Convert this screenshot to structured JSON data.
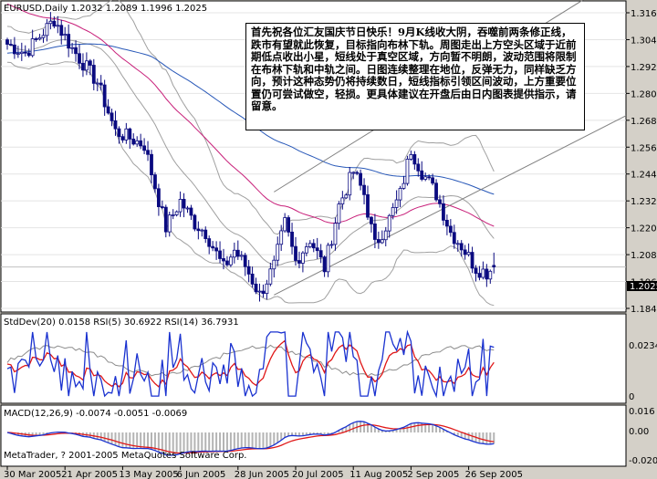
{
  "colors": {
    "background": "#ffffff",
    "frame": "#d4d0c8",
    "candle": "#0a0a80",
    "bollinger": "#a0a0a0",
    "ma_magenta": "#c8207a",
    "ma_blue": "#2858b8",
    "channel": "#808080",
    "rsi_red": "#e01818",
    "rsi_blue": "#1a32d0",
    "stddev_gray": "#8c8c8c",
    "macd_line": "#1a32d0",
    "macd_signal": "#e01818",
    "macd_hist": "#b4b4b4"
  },
  "price_panel": {
    "header": "EURUSD,Daily  1.2032 1.2089 1.1996 1.2025",
    "current_label": "1.2025",
    "note": "首先祝各位汇友国庆节日快乐！9月K线收大阴，吞噬前两条修正线，跌市有望就此恢复，目标指向布林下轨。周图走出上方空头区域于近前期低点收出小星，短线处于真空区域，方向暂不明朗，波动范围将限制在布林下轨和中轨之间。日图连续整理在地位，反弹无力，同样缺乏方向，预计这种态势仍将持续数日，短线指标引领区间波动，上方重要位置仍可尝试做空，轻损。更具体建议在开盘后由日内图表提供指示，请留意。"
  },
  "indicator_panel": {
    "header": "StdDev(20) 0.0158  RSI(5) 30.6922  RSI(14) 36.7931"
  },
  "macd_panel": {
    "header": "MACD(12,26,9) -0.0074 -0.0051 -0.0069",
    "copyright": "MetaTrader, ? 2001-2005 MetaQuotes Software Corp."
  },
  "chart_data": [
    {
      "type": "candlestick",
      "title": "EURUSD,Daily  1.2032 1.2089 1.1996 1.2025",
      "x_tick_labels": [
        "30 Mar 2005",
        "21 Apr 2005",
        "13 May 2005",
        "6 Jun 2005",
        "28 Jun 2005",
        "20 Jul 2005",
        "11 Aug 2005",
        "2 Sep 2005",
        "26 Sep 2005"
      ],
      "y_tick_labels": [
        "1.3160",
        "1.3040",
        "1.2920",
        "1.2800",
        "1.2680",
        "1.2560",
        "1.2440",
        "1.2320",
        "1.2200",
        "1.2080",
        "1.1960",
        "1.1840"
      ],
      "ylim": [
        1.184,
        1.316
      ],
      "bars": 136,
      "price_path": [
        [
          0,
          1.302
        ],
        [
          5,
          1.298
        ],
        [
          13,
          1.313
        ],
        [
          18,
          1.3
        ],
        [
          25,
          1.285
        ],
        [
          30,
          1.263
        ],
        [
          38,
          1.257
        ],
        [
          44,
          1.22
        ],
        [
          48,
          1.232
        ],
        [
          52,
          1.222
        ],
        [
          55,
          1.218
        ],
        [
          60,
          1.202
        ],
        [
          63,
          1.21
        ],
        [
          66,
          1.203
        ],
        [
          70,
          1.19
        ],
        [
          74,
          1.203
        ],
        [
          77,
          1.222
        ],
        [
          80,
          1.205
        ],
        [
          84,
          1.215
        ],
        [
          88,
          1.202
        ],
        [
          92,
          1.23
        ],
        [
          96,
          1.245
        ],
        [
          99,
          1.235
        ],
        [
          102,
          1.212
        ],
        [
          106,
          1.224
        ],
        [
          109,
          1.235
        ],
        [
          112,
          1.255
        ],
        [
          115,
          1.245
        ],
        [
          119,
          1.235
        ],
        [
          123,
          1.218
        ],
        [
          126,
          1.212
        ],
        [
          130,
          1.202
        ],
        [
          133,
          1.2
        ],
        [
          135,
          1.2025
        ]
      ],
      "last": {
        "open": 1.2032,
        "high": 1.2089,
        "low": 1.1996,
        "close": 1.2025
      },
      "bollinger": {
        "period": 20
      },
      "moving_averages": [
        "magenta",
        "blue"
      ],
      "trend_channel": {
        "lower": [
          [
            74,
            1.19
          ],
          [
            135,
            1.24
          ]
        ],
        "upper": [
          [
            74,
            1.236
          ],
          [
            130,
            1.292
          ]
        ]
      }
    },
    {
      "type": "line",
      "title": "StdDev(20) 0.0158  RSI(5) 30.6922  RSI(14) 36.7931",
      "series": [
        {
          "name": "StdDev(20)",
          "last": 0.0158
        },
        {
          "name": "RSI(5)",
          "last": 30.6922
        },
        {
          "name": "RSI(14)",
          "last": 36.7931
        }
      ],
      "y_tick_labels": [
        "0.0234",
        "0"
      ]
    },
    {
      "type": "bar",
      "title": "MACD(12,26,9) -0.0074 -0.0051 -0.0069",
      "values_last": {
        "macd": -0.0074,
        "signal": -0.0051,
        "hist": -0.0069
      },
      "y_tick_labels": [
        "0.016",
        "0.00",
        "-0.0209"
      ]
    }
  ]
}
